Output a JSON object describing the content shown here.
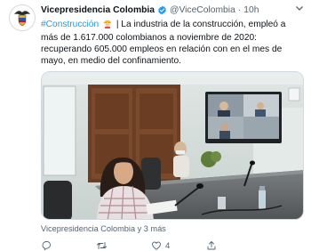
{
  "tweet": {
    "author_name": "Vicepresidencia Colombia",
    "handle": "@ViceColombia",
    "separator": "·",
    "time": "10h",
    "hashtag": "#Construcción",
    "body_line1": "| La industria de la construcción, empleó a más de",
    "body_rest": "1.617.000 colombianos a noviembre de 2020: recuperando 605.000 empleos en relación con en el mes de mayo, en medio del confinamiento.",
    "media_footer": "Vicepresidencia Colombia y 3 más",
    "replies": "",
    "retweets": "",
    "likes": "4"
  },
  "colors": {
    "link": "#1d9bf0",
    "verified": "#1d9bf0",
    "secondary_text": "#536471",
    "text": "#0f1419"
  },
  "icons": [
    "verified-badge-icon",
    "caret-down-icon",
    "construction-worker-emoji",
    "reply-icon",
    "retweet-icon",
    "like-icon",
    "share-icon"
  ]
}
